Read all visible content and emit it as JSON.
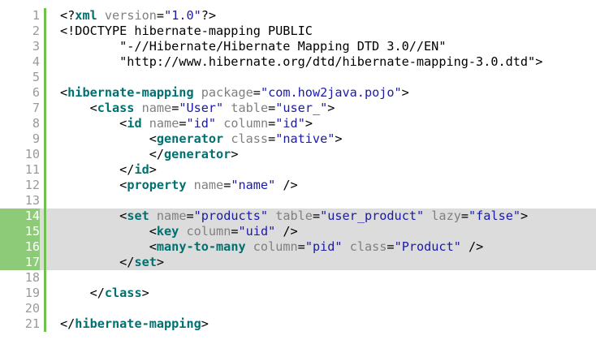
{
  "editor": {
    "colors": {
      "tag": "#007070",
      "attribute": "#808080",
      "string": "#1a1aa6",
      "text": "#000000",
      "highlight_background": "#dcdcdc",
      "highlight_gutter": "#8dcb79",
      "gutter_bar": "#6fc04f",
      "line_number": "#9a9a9a"
    },
    "highlighted_lines": [
      14,
      15,
      16,
      17
    ],
    "lines": [
      {
        "number": "1",
        "tokens": [
          {
            "t": "ang",
            "v": "<?"
          },
          {
            "t": "tag",
            "v": "xml"
          },
          {
            "t": "ws",
            "v": " "
          },
          {
            "t": "attr",
            "v": "version"
          },
          {
            "t": "eq",
            "v": "="
          },
          {
            "t": "str",
            "v": "\"1.0\""
          },
          {
            "t": "ang",
            "v": "?>"
          }
        ]
      },
      {
        "number": "2",
        "tokens": [
          {
            "t": "doc",
            "v": "<!DOCTYPE hibernate-mapping PUBLIC"
          }
        ]
      },
      {
        "number": "3",
        "tokens": [
          {
            "t": "doc",
            "v": "        \"-//Hibernate/Hibernate Mapping DTD 3.0//EN\""
          }
        ]
      },
      {
        "number": "4",
        "tokens": [
          {
            "t": "doc",
            "v": "        \"http://www.hibernate.org/dtd/hibernate-mapping-3.0.dtd\">"
          }
        ]
      },
      {
        "number": "5",
        "tokens": []
      },
      {
        "number": "6",
        "tokens": [
          {
            "t": "ang",
            "v": "<"
          },
          {
            "t": "tag",
            "v": "hibernate-mapping"
          },
          {
            "t": "ws",
            "v": " "
          },
          {
            "t": "attr",
            "v": "package"
          },
          {
            "t": "eq",
            "v": "="
          },
          {
            "t": "str",
            "v": "\"com.how2java.pojo\""
          },
          {
            "t": "ang",
            "v": ">"
          }
        ]
      },
      {
        "number": "7",
        "tokens": [
          {
            "t": "ws",
            "v": "    "
          },
          {
            "t": "ang",
            "v": "<"
          },
          {
            "t": "tag",
            "v": "class"
          },
          {
            "t": "ws",
            "v": " "
          },
          {
            "t": "attr",
            "v": "name"
          },
          {
            "t": "eq",
            "v": "="
          },
          {
            "t": "str",
            "v": "\"User\""
          },
          {
            "t": "ws",
            "v": " "
          },
          {
            "t": "attr",
            "v": "table"
          },
          {
            "t": "eq",
            "v": "="
          },
          {
            "t": "str",
            "v": "\"user_\""
          },
          {
            "t": "ang",
            "v": ">"
          }
        ]
      },
      {
        "number": "8",
        "tokens": [
          {
            "t": "ws",
            "v": "        "
          },
          {
            "t": "ang",
            "v": "<"
          },
          {
            "t": "tag",
            "v": "id"
          },
          {
            "t": "ws",
            "v": " "
          },
          {
            "t": "attr",
            "v": "name"
          },
          {
            "t": "eq",
            "v": "="
          },
          {
            "t": "str",
            "v": "\"id\""
          },
          {
            "t": "ws",
            "v": " "
          },
          {
            "t": "attr",
            "v": "column"
          },
          {
            "t": "eq",
            "v": "="
          },
          {
            "t": "str",
            "v": "\"id\""
          },
          {
            "t": "ang",
            "v": ">"
          }
        ]
      },
      {
        "number": "9",
        "tokens": [
          {
            "t": "ws",
            "v": "            "
          },
          {
            "t": "ang",
            "v": "<"
          },
          {
            "t": "tag",
            "v": "generator"
          },
          {
            "t": "ws",
            "v": " "
          },
          {
            "t": "attr",
            "v": "class"
          },
          {
            "t": "eq",
            "v": "="
          },
          {
            "t": "str",
            "v": "\"native\""
          },
          {
            "t": "ang",
            "v": ">"
          }
        ]
      },
      {
        "number": "10",
        "tokens": [
          {
            "t": "ws",
            "v": "            "
          },
          {
            "t": "ang",
            "v": "</"
          },
          {
            "t": "tag",
            "v": "generator"
          },
          {
            "t": "ang",
            "v": ">"
          }
        ]
      },
      {
        "number": "11",
        "tokens": [
          {
            "t": "ws",
            "v": "        "
          },
          {
            "t": "ang",
            "v": "</"
          },
          {
            "t": "tag",
            "v": "id"
          },
          {
            "t": "ang",
            "v": ">"
          }
        ]
      },
      {
        "number": "12",
        "tokens": [
          {
            "t": "ws",
            "v": "        "
          },
          {
            "t": "ang",
            "v": "<"
          },
          {
            "t": "tag",
            "v": "property"
          },
          {
            "t": "ws",
            "v": " "
          },
          {
            "t": "attr",
            "v": "name"
          },
          {
            "t": "eq",
            "v": "="
          },
          {
            "t": "str",
            "v": "\"name\""
          },
          {
            "t": "ws",
            "v": " "
          },
          {
            "t": "ang",
            "v": "/>"
          }
        ]
      },
      {
        "number": "13",
        "tokens": []
      },
      {
        "number": "14",
        "tokens": [
          {
            "t": "ws",
            "v": "        "
          },
          {
            "t": "ang",
            "v": "<"
          },
          {
            "t": "tag",
            "v": "set"
          },
          {
            "t": "ws",
            "v": " "
          },
          {
            "t": "attr",
            "v": "name"
          },
          {
            "t": "eq",
            "v": "="
          },
          {
            "t": "str",
            "v": "\"products\""
          },
          {
            "t": "ws",
            "v": " "
          },
          {
            "t": "attr",
            "v": "table"
          },
          {
            "t": "eq",
            "v": "="
          },
          {
            "t": "str",
            "v": "\"user_product\""
          },
          {
            "t": "ws",
            "v": " "
          },
          {
            "t": "attr",
            "v": "lazy"
          },
          {
            "t": "eq",
            "v": "="
          },
          {
            "t": "str",
            "v": "\"false\""
          },
          {
            "t": "ang",
            "v": ">"
          }
        ]
      },
      {
        "number": "15",
        "tokens": [
          {
            "t": "ws",
            "v": "            "
          },
          {
            "t": "ang",
            "v": "<"
          },
          {
            "t": "tag",
            "v": "key"
          },
          {
            "t": "ws",
            "v": " "
          },
          {
            "t": "attr",
            "v": "column"
          },
          {
            "t": "eq",
            "v": "="
          },
          {
            "t": "str",
            "v": "\"uid\""
          },
          {
            "t": "ws",
            "v": " "
          },
          {
            "t": "ang",
            "v": "/>"
          }
        ]
      },
      {
        "number": "16",
        "tokens": [
          {
            "t": "ws",
            "v": "            "
          },
          {
            "t": "ang",
            "v": "<"
          },
          {
            "t": "tag",
            "v": "many-to-many"
          },
          {
            "t": "ws",
            "v": " "
          },
          {
            "t": "attr",
            "v": "column"
          },
          {
            "t": "eq",
            "v": "="
          },
          {
            "t": "str",
            "v": "\"pid\""
          },
          {
            "t": "ws",
            "v": " "
          },
          {
            "t": "attr",
            "v": "class"
          },
          {
            "t": "eq",
            "v": "="
          },
          {
            "t": "str",
            "v": "\"Product\""
          },
          {
            "t": "ws",
            "v": " "
          },
          {
            "t": "ang",
            "v": "/>"
          }
        ]
      },
      {
        "number": "17",
        "tokens": [
          {
            "t": "ws",
            "v": "        "
          },
          {
            "t": "ang",
            "v": "</"
          },
          {
            "t": "tag",
            "v": "set"
          },
          {
            "t": "ang",
            "v": ">"
          }
        ]
      },
      {
        "number": "18",
        "tokens": []
      },
      {
        "number": "19",
        "tokens": [
          {
            "t": "ws",
            "v": "    "
          },
          {
            "t": "ang",
            "v": "</"
          },
          {
            "t": "tag",
            "v": "class"
          },
          {
            "t": "ang",
            "v": ">"
          }
        ]
      },
      {
        "number": "20",
        "tokens": []
      },
      {
        "number": "21",
        "tokens": [
          {
            "t": "ang",
            "v": "</"
          },
          {
            "t": "tag",
            "v": "hibernate-mapping"
          },
          {
            "t": "ang",
            "v": ">"
          }
        ]
      }
    ]
  }
}
